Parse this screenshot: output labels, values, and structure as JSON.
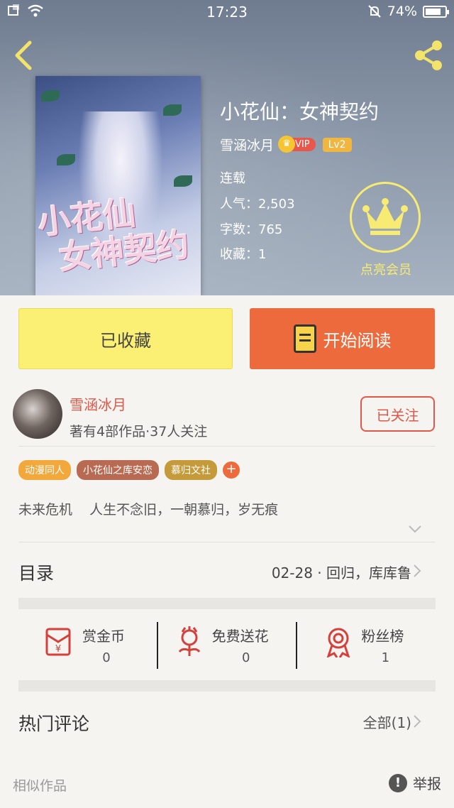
{
  "status_bar": {
    "time": "17:23",
    "battery": "74%"
  },
  "book": {
    "title": "小花仙：女神契约",
    "author": "雪涵冰月",
    "vip": "VIP",
    "level": "Lv2",
    "status": "连载",
    "popularity": "人气：2,503",
    "word_count": "字数：765",
    "favorites": "收藏：1",
    "cover_title_line1": "小花仙",
    "cover_title_line2": "女神契约"
  },
  "member": {
    "label": "点亮会员"
  },
  "actions": {
    "collected_label": "已收藏",
    "read_label": "开始阅读"
  },
  "author_panel": {
    "name": "雪涵冰月",
    "meta": "著有4部作品·37人关注",
    "follow_label": "已关注"
  },
  "tags": [
    {
      "label": "动漫同人",
      "color": "#f2a83a"
    },
    {
      "label": "小花仙之库安恋",
      "color": "#b96a52"
    },
    {
      "label": "慕归文社",
      "color": "#c49a3a"
    }
  ],
  "intro": "未来危机    人生不念旧，一朝慕归，岁无痕",
  "toc": {
    "label": "目录",
    "latest": "02-28 · 回归，库库鲁"
  },
  "rewards": [
    {
      "label": "赏金币",
      "value": "0",
      "icon": "red-envelope-icon"
    },
    {
      "label": "免费送花",
      "value": "0",
      "icon": "flower-icon"
    },
    {
      "label": "粉丝榜",
      "value": "1",
      "icon": "medal-icon"
    }
  ],
  "comments": {
    "label": "热门评论",
    "all": "全部(1)"
  },
  "footer": {
    "similar": "相似作品",
    "report": "举报"
  },
  "colors": {
    "accent_orange": "#ec6a3c",
    "accent_red": "#e0584a",
    "collect_yellow": "#fbef74"
  }
}
